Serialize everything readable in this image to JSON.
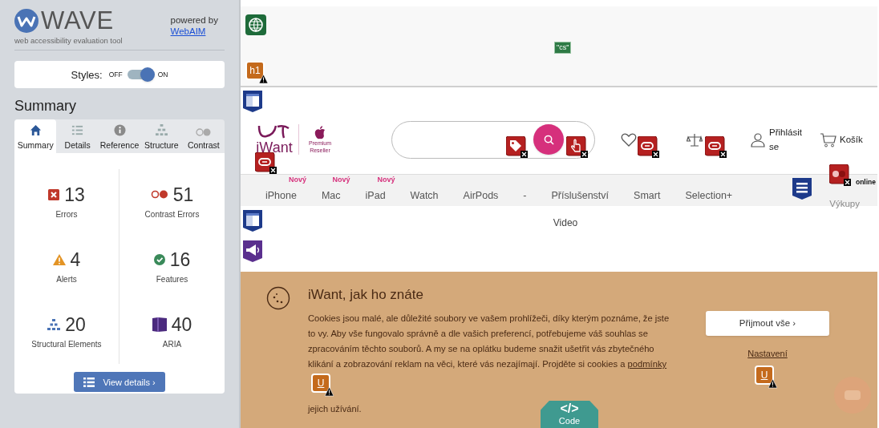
{
  "wave": {
    "logo": "WAVE",
    "tagline": "web accessibility evaluation tool",
    "powered_by": "powered by",
    "powered_link": "WebAIM",
    "styles_toggle": {
      "label": "Styles:",
      "off_label": "OFF",
      "on_label": "ON",
      "on": true
    },
    "heading": "Summary",
    "tabs": [
      {
        "label": "Summary",
        "selected": true
      },
      {
        "label": "Details",
        "selected": false
      },
      {
        "label": "Reference",
        "selected": false
      },
      {
        "label": "Structure",
        "selected": false
      },
      {
        "label": "Contrast",
        "selected": false
      }
    ],
    "stats": [
      {
        "kind": "errors",
        "count": "13",
        "label": "Errors"
      },
      {
        "kind": "contrast",
        "count": "51",
        "label": "Contrast Errors"
      },
      {
        "kind": "alerts",
        "count": "4",
        "label": "Alerts"
      },
      {
        "kind": "features",
        "count": "16",
        "label": "Features"
      },
      {
        "kind": "structure",
        "count": "20",
        "label": "Structural Elements"
      },
      {
        "kind": "aria",
        "count": "40",
        "label": "ARIA"
      }
    ],
    "details_button": "View details ›"
  },
  "page": {
    "header": {
      "logo": "iWant",
      "reseller": [
        "Premium",
        "Reseller"
      ],
      "actions": [
        {
          "kind": "wishlist"
        },
        {
          "kind": "compare"
        },
        {
          "kind": "account",
          "label": "Přihlásit se"
        },
        {
          "kind": "cart",
          "label": "Košík"
        }
      ]
    },
    "nav": [
      {
        "label": "iPhone",
        "badge": "Nový"
      },
      {
        "label": "Mac",
        "badge": "Nový"
      },
      {
        "label": "iPad",
        "badge": "Nový"
      },
      {
        "label": "Watch"
      },
      {
        "label": "AirPods"
      },
      {
        "label": "-"
      },
      {
        "label": "Příslušenství"
      },
      {
        "label": "Smart"
      },
      {
        "label": "Selection+"
      }
    ],
    "nav_extra": {
      "caption": "online",
      "label": "Výkupy"
    },
    "video_label": "Video",
    "cookie_banner": {
      "title": "iWant, jak ho znáte",
      "text": "Cookies jsou malé, ale důležité soubory ve vašem prohlížeči, díky kterým poznáme, že jste to vy. Aby vše fungovalo správně a dle vašich preferencí, potřebujeme váš souhlas se zpracováním těchto souborů. A my se na oplátku budeme snažit ušetřit vás zbytečného klikání a zobrazování reklam na věci, které vás nezajímají. Projděte si cookies a",
      "link": "podmínky",
      "tail": "jejich užívání.",
      "accept": "Přijmout vše ›",
      "settings": "Nastavení"
    },
    "markers": [
      {
        "kind": "language"
      },
      {
        "kind": "language_tag",
        "text": "\"cs\""
      },
      {
        "kind": "heading_alert",
        "text": "h1"
      },
      {
        "kind": "landmark"
      },
      {
        "kind": "link_error"
      },
      {
        "kind": "alt_error"
      },
      {
        "kind": "button_error"
      },
      {
        "kind": "link_error"
      },
      {
        "kind": "link_error"
      },
      {
        "kind": "contrast_error"
      },
      {
        "kind": "nav_landmark"
      },
      {
        "kind": "landmark"
      },
      {
        "kind": "aria_live"
      },
      {
        "kind": "underline_alert",
        "text": "U"
      },
      {
        "kind": "underline_alert",
        "text": "U"
      },
      {
        "kind": "code",
        "glyph": "</>",
        "text": "Code"
      }
    ]
  }
}
